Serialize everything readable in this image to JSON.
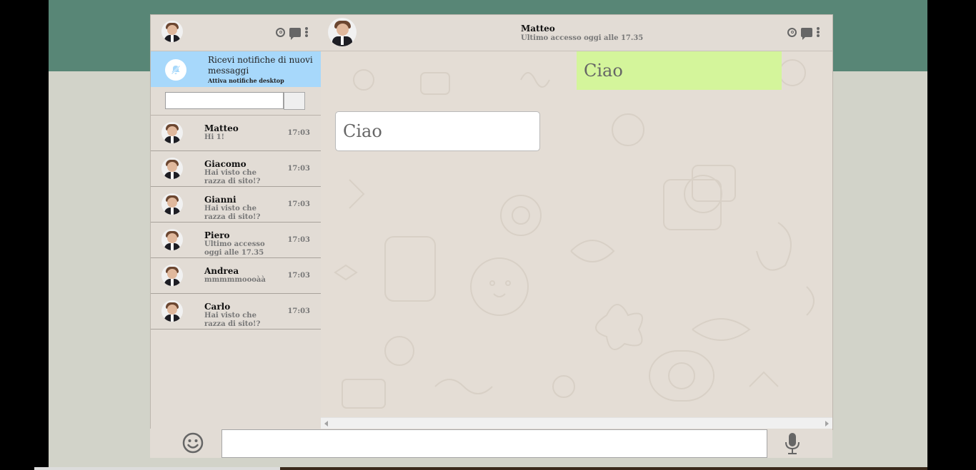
{
  "left_header": {
    "avatar": "profile-photo",
    "icons": [
      "user-circle-icon",
      "chat-icon",
      "menu-dots-icon"
    ]
  },
  "notification": {
    "icon": "bell-off-icon",
    "title": "Ricevi notifiche di nuovi messaggi",
    "subtitle": "Attiva notifiche desktop"
  },
  "search": {
    "value": "",
    "placeholder": ""
  },
  "chats": [
    {
      "name": "Matteo",
      "preview": "Hi 1!",
      "time": "17:03"
    },
    {
      "name": "Giacomo",
      "preview": "Hai visto che razza di sito!?",
      "time": "17:03"
    },
    {
      "name": "Gianni",
      "preview": "Hai visto che razza di sito!?",
      "time": "17:03"
    },
    {
      "name": "Piero",
      "preview": "Ultimo accesso oggi alle 17.35",
      "time": "17:03"
    },
    {
      "name": "Andrea",
      "preview": "mmmmmoooàà",
      "time": "17:03"
    },
    {
      "name": "Carlo",
      "preview": "Hai visto che razza di sito!?",
      "time": "17:03"
    }
  ],
  "conversation_header": {
    "name": "Matteo",
    "status": "Ultimo accesso oggi alle 17.35"
  },
  "messages": [
    {
      "direction": "outgoing",
      "text": "Ciao",
      "color": "#d4f59b"
    },
    {
      "direction": "incoming",
      "text": "Ciao",
      "color": "#ffffff"
    }
  ],
  "composer": {
    "value": "",
    "placeholder": "",
    "emoji_icon": "smiley-icon",
    "mic_icon": "microphone-icon"
  },
  "colors": {
    "header_band": "#588676",
    "panel": "#e2dcd5",
    "notification": "#a7d8fb",
    "outgoing_bubble": "#d4f59b"
  }
}
